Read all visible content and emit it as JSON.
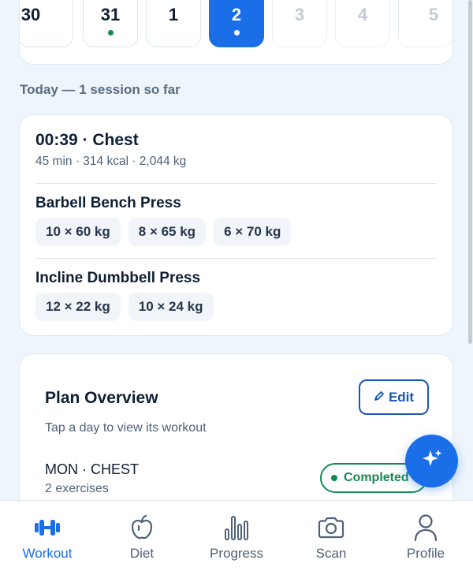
{
  "date_strip": {
    "days": [
      {
        "num": "30",
        "state": "past",
        "dot": false
      },
      {
        "num": "31",
        "state": "past",
        "dot": true
      },
      {
        "num": "1",
        "state": "past",
        "dot": false
      },
      {
        "num": "2",
        "state": "selected",
        "dot": true
      },
      {
        "num": "3",
        "state": "future",
        "dot": false
      },
      {
        "num": "4",
        "state": "future",
        "dot": false
      },
      {
        "num": "5",
        "state": "future",
        "dot": false
      }
    ]
  },
  "today_label": "Today — 1 session so far",
  "session": {
    "title": "00:39 · Chest",
    "meta": "45 min · 314 kcal · 2,044 kg",
    "exercises": [
      {
        "name": "Barbell Bench Press",
        "sets": [
          "10 × 60 kg",
          "8 × 65 kg",
          "6 × 70 kg"
        ]
      },
      {
        "name": "Incline Dumbbell Press",
        "sets": [
          "12 × 22 kg",
          "10 × 24 kg"
        ]
      }
    ]
  },
  "plan": {
    "title": "Plan Overview",
    "edit_label": "Edit",
    "edit_icon": "pencil-icon",
    "hint": "Tap a day to view its workout",
    "first_day": {
      "label": "MON · CHEST",
      "count": "2 exercises",
      "status": "Completed"
    }
  },
  "fab": {
    "icon": "sparkle-icon"
  },
  "tabs": [
    {
      "label": "Workout",
      "icon": "dumbbell-icon",
      "active": true
    },
    {
      "label": "Diet",
      "icon": "apple-icon",
      "active": false
    },
    {
      "label": "Progress",
      "icon": "bar-chart-icon",
      "active": false
    },
    {
      "label": "Scan",
      "icon": "camera-icon",
      "active": false
    },
    {
      "label": "Profile",
      "icon": "user-icon",
      "active": false
    }
  ],
  "colors": {
    "accent": "#1a6ee8",
    "success": "#138a52",
    "background": "#eef5fd"
  }
}
